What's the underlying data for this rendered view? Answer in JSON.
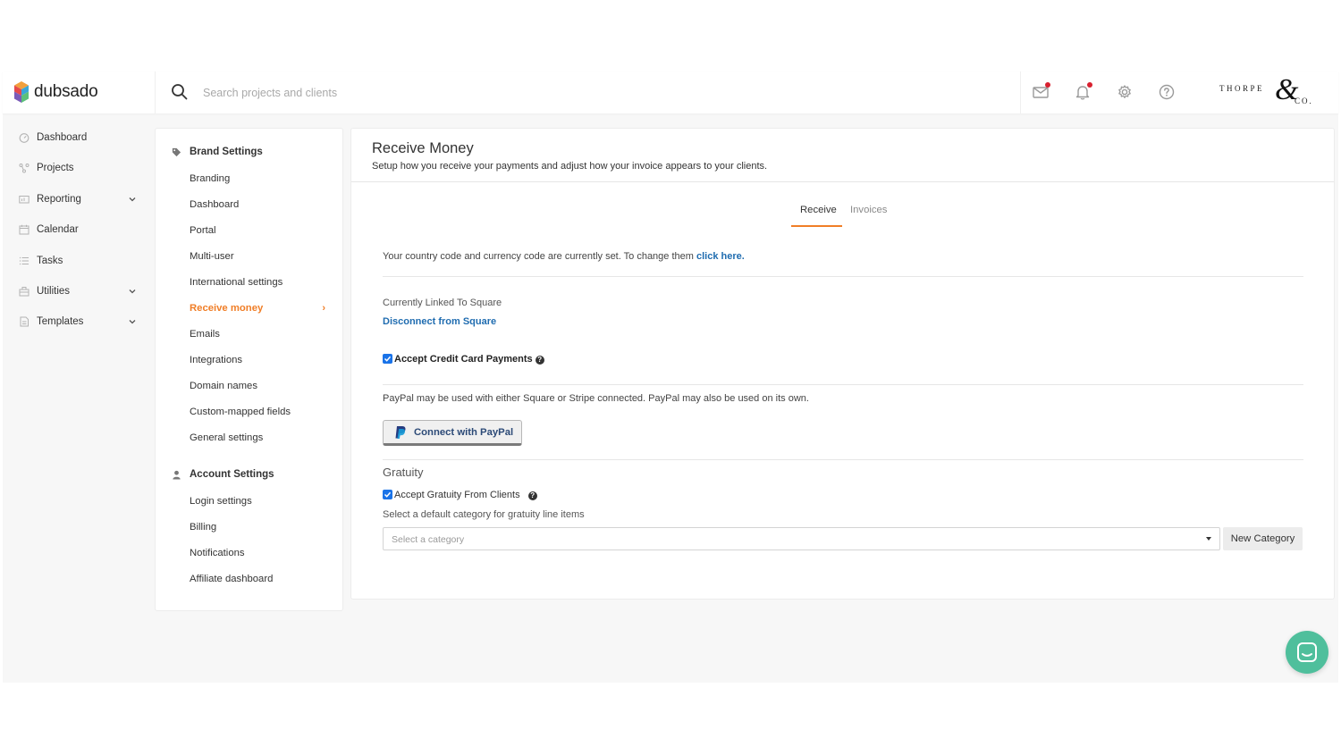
{
  "app": {
    "name": "dubsado"
  },
  "header": {
    "search_placeholder": "Search projects and clients",
    "icons": [
      "mail-icon",
      "bell-icon",
      "gear-icon",
      "help-icon"
    ],
    "brand_logo": {
      "name": "THORPE",
      "amp": "&",
      "suffix": "CO."
    },
    "accent": "#f07e27"
  },
  "leftnav": {
    "items": [
      {
        "label": "Dashboard",
        "icon": "dashboard-icon",
        "has_chevron": false
      },
      {
        "label": "Projects",
        "icon": "projects-icon",
        "has_chevron": false
      },
      {
        "label": "Reporting",
        "icon": "reporting-icon",
        "has_chevron": true
      },
      {
        "label": "Calendar",
        "icon": "calendar-icon",
        "has_chevron": false
      },
      {
        "label": "Tasks",
        "icon": "tasks-icon",
        "has_chevron": false
      },
      {
        "label": "Utilities",
        "icon": "utilities-icon",
        "has_chevron": true
      },
      {
        "label": "Templates",
        "icon": "templates-icon",
        "has_chevron": true
      }
    ]
  },
  "settings": {
    "brand": {
      "title": "Brand Settings",
      "items": [
        "Branding",
        "Dashboard",
        "Portal",
        "Multi-user",
        "International settings",
        "Receive money",
        "Emails",
        "Integrations",
        "Domain names",
        "Custom-mapped fields",
        "General settings"
      ],
      "active": "Receive money",
      "active_arrow": "›"
    },
    "account": {
      "title": "Account Settings",
      "items": [
        "Login settings",
        "Billing",
        "Notifications",
        "Affiliate dashboard"
      ]
    }
  },
  "main": {
    "title": "Receive Money",
    "subtitle": "Setup how you receive your payments and adjust how your invoice appears to your clients.",
    "tabs": [
      {
        "label": "Receive",
        "active": true
      },
      {
        "label": "Invoices",
        "active": false
      }
    ],
    "country_text": "Your country code and currency code are currently set. To change them ",
    "country_link": "click here.",
    "linked_text": "Currently Linked To Square",
    "disconnect_link": "Disconnect from Square",
    "accept_cc": {
      "label": "Accept Credit Card Payments",
      "checked": true
    },
    "paypal_note": "PayPal may be used with either Square or Stripe connected. PayPal may also be used on its own.",
    "paypal_button": "Connect with PayPal",
    "gratuity": {
      "title": "Gratuity",
      "accept_label": "Accept Gratuity From Clients",
      "checked": true,
      "category_label": "Select a default category for gratuity line items",
      "select_placeholder": "Select a category",
      "new_category_button": "New Category"
    },
    "help_glyph": "?"
  },
  "chat": {
    "icon": "chat-icon",
    "color": "#4fbf9c"
  }
}
